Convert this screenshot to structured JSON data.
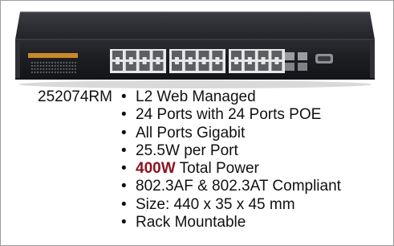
{
  "product": {
    "model": "252074RM",
    "image_alt": "24-port rack mount gigabit PoE switch",
    "features": [
      {
        "text": "L2 Web Managed"
      },
      {
        "text": "24 Ports with 24 Ports POE"
      },
      {
        "text": "All Ports Gigabit"
      },
      {
        "text": "25.5W per Port"
      },
      {
        "highlight": "400W",
        "text": " Total Power"
      },
      {
        "text": "802.3AF & 802.3AT Compliant"
      },
      {
        "text": "Size: 440 x 35 x 45 mm"
      },
      {
        "text": "Rack Mountable"
      }
    ]
  },
  "icons": {
    "bullet": "bullet-icon"
  },
  "colors": {
    "border": "#9e9e9e",
    "text": "#111111",
    "highlight": "#8b1420",
    "switch_body": "#1e1f24",
    "switch_label": "#c98a2a"
  }
}
